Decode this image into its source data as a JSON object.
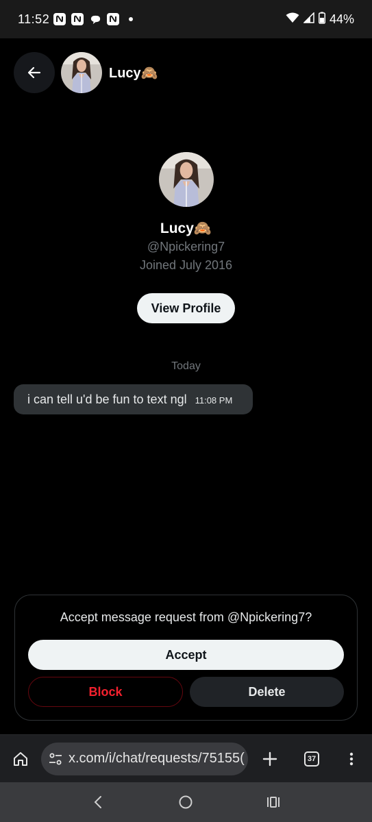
{
  "status_bar": {
    "time": "11:52",
    "battery": "44%",
    "icons": [
      "app-n-icon",
      "app-n-icon",
      "chat-bubble-icon",
      "app-n-icon",
      "dot-icon",
      "wifi-icon",
      "signal-icon",
      "battery-icon"
    ]
  },
  "header": {
    "name": "Lucy🙈",
    "back_icon": "arrow-left-icon"
  },
  "profile": {
    "name": "Lucy🙈",
    "handle": "@Npickering7",
    "joined": "Joined July 2016",
    "view_profile_label": "View Profile"
  },
  "conversation": {
    "date_separator": "Today",
    "messages": [
      {
        "text": "i can tell u'd be fun to text ngl",
        "time": "11:08 PM"
      }
    ]
  },
  "request": {
    "prompt": "Accept message request from @Npickering7?",
    "accept_label": "Accept",
    "block_label": "Block",
    "delete_label": "Delete"
  },
  "browser": {
    "url": "x.com/i/chat/requests/75155(",
    "tab_count": "37"
  },
  "colors": {
    "background": "#000000",
    "accent_red": "#f4212e",
    "muted": "#71767b",
    "bubble": "#2f3336"
  }
}
